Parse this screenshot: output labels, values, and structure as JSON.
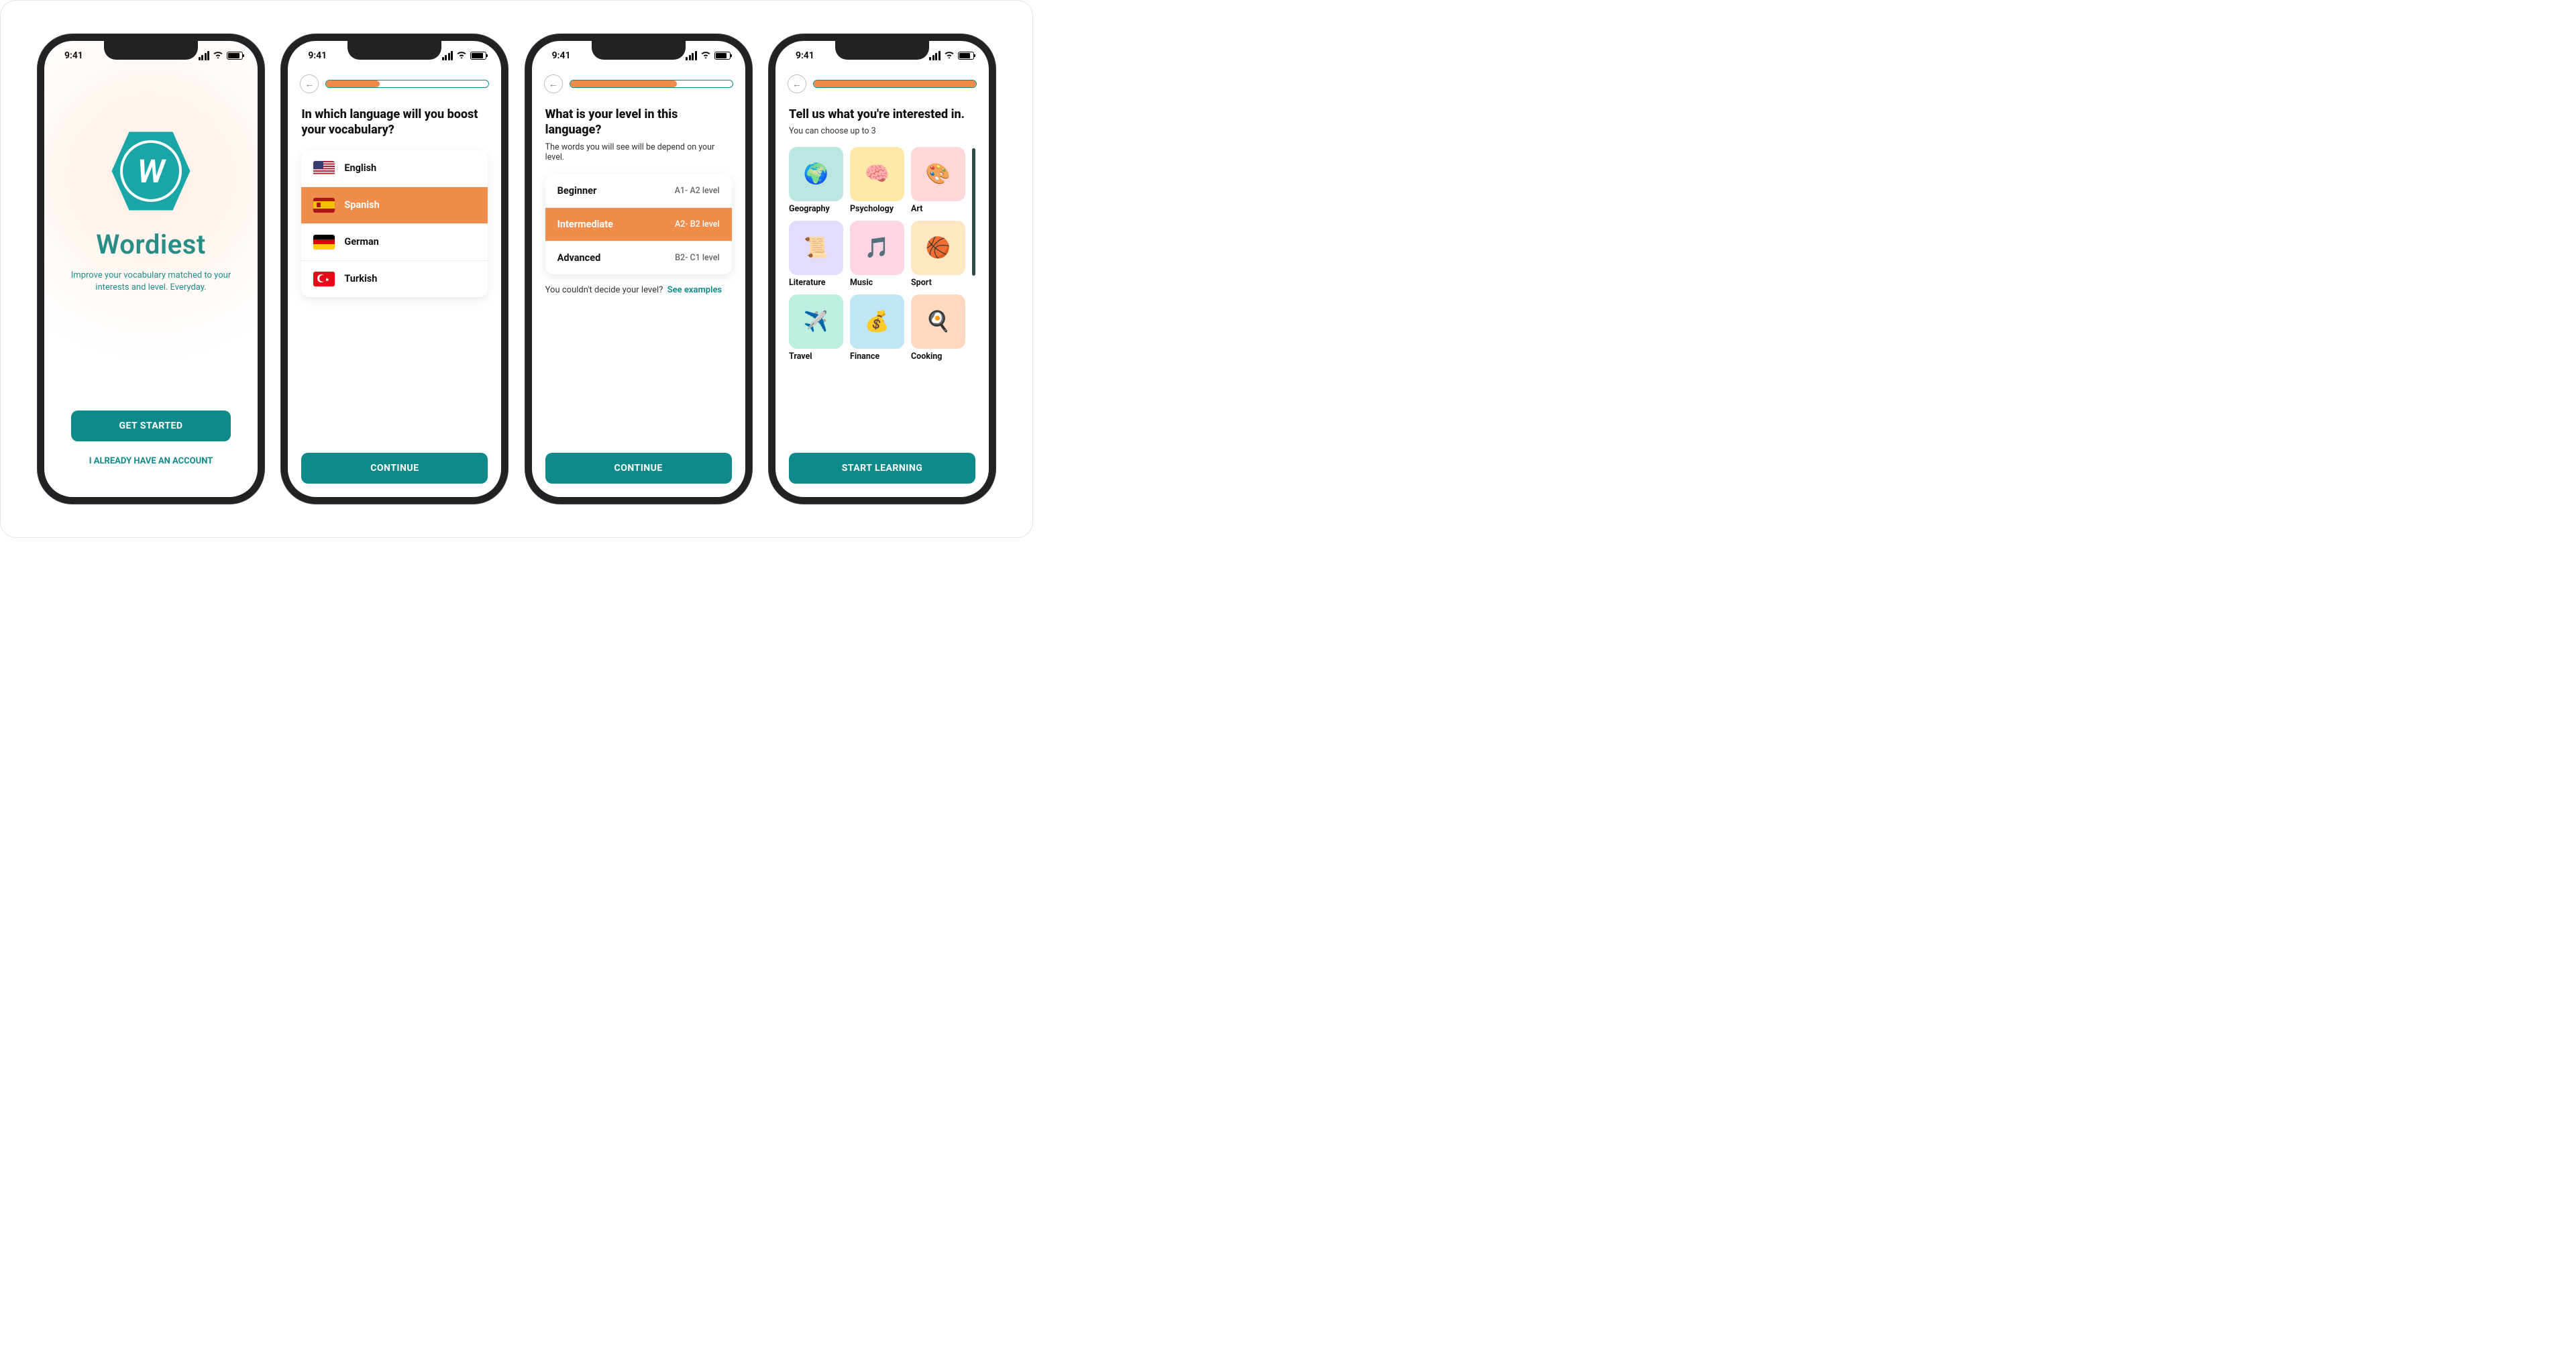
{
  "status": {
    "time": "9:41"
  },
  "colors": {
    "primary": "#0e8a8a",
    "accent": "#f08c4a"
  },
  "screen1": {
    "logo_letter": "W",
    "app_name": "Wordiest",
    "tagline": "Improve your vocabulary matched to your interests and level. Everyday.",
    "cta": "GET STARTED",
    "login_link": "I ALREADY HAVE AN ACCOUNT"
  },
  "screen2": {
    "progress_pct": 33,
    "title": "In which language will you boost your vocabulary?",
    "cta": "CONTINUE",
    "languages": [
      {
        "name": "English",
        "flag": "us",
        "selected": false
      },
      {
        "name": "Spanish",
        "flag": "es",
        "selected": true
      },
      {
        "name": "German",
        "flag": "de",
        "selected": false
      },
      {
        "name": "Turkish",
        "flag": "tr",
        "selected": false
      }
    ]
  },
  "screen3": {
    "progress_pct": 66,
    "title": "What is your level in this language?",
    "subtitle": "The words you will see will be depend on your level.",
    "cta": "CONTINUE",
    "hint_text": "You couldn't decide your level?",
    "hint_link": "See examples",
    "levels": [
      {
        "name": "Beginner",
        "range": "A1- A2 level",
        "selected": false
      },
      {
        "name": "Intermediate",
        "range": "A2- B2 level",
        "selected": true
      },
      {
        "name": "Advanced",
        "range": "B2- C1 level",
        "selected": false
      }
    ]
  },
  "screen4": {
    "progress_pct": 100,
    "title": "Tell us what you're interested in.",
    "subtitle": "You can choose up to 3",
    "cta": "START LEARNING",
    "interests": [
      {
        "name": "Geography",
        "bg": "#bce7e1",
        "icon": "🌍"
      },
      {
        "name": "Psychology",
        "bg": "#ffe9a8",
        "icon": "🧠"
      },
      {
        "name": "Art",
        "bg": "#ffd7d7",
        "icon": "🎨"
      },
      {
        "name": "Literature",
        "bg": "#e4dcff",
        "icon": "📜"
      },
      {
        "name": "Music",
        "bg": "#ffd4e3",
        "icon": "🎵"
      },
      {
        "name": "Sport",
        "bg": "#ffe7c2",
        "icon": "🏀"
      },
      {
        "name": "Travel",
        "bg": "#bdeee0",
        "icon": "✈️"
      },
      {
        "name": "Finance",
        "bg": "#bfe6f5",
        "icon": "💰"
      },
      {
        "name": "Cooking",
        "bg": "#ffd9bf",
        "icon": "🍳"
      }
    ]
  }
}
